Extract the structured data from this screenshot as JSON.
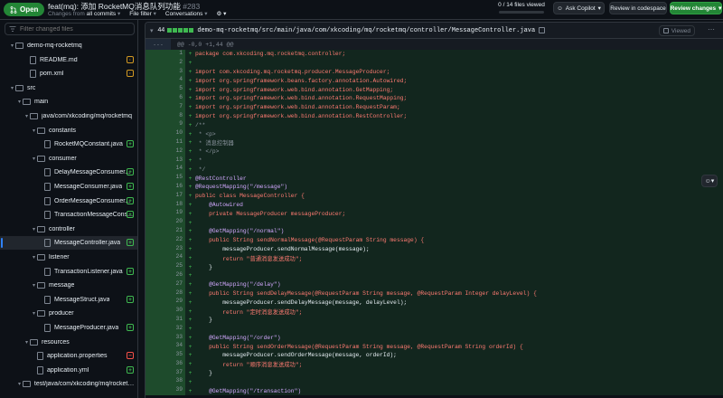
{
  "header": {
    "status_label": "Open",
    "pr_title": "feat(mq): 添加 RocketMQ消息队列功能",
    "pr_number": "#283",
    "changes_from_prefix": "Changes from",
    "changes_from_value": "all commits",
    "file_filter_label": "File filter",
    "conversations_label": "Conversations",
    "files_viewed": "0 / 14 files viewed",
    "ask_copilot_label": "Ask Copilot",
    "review_codespace_label": "Review in codespace",
    "review_changes_label": "Review changes"
  },
  "sidebar": {
    "filter_placeholder": "Filter changed files",
    "items": [
      {
        "label": "demo-mq-rocketmq",
        "type": "folder",
        "status": ""
      },
      {
        "label": "README.md",
        "type": "file",
        "status": "modified"
      },
      {
        "label": "pom.xml",
        "type": "file",
        "status": "modified"
      },
      {
        "label": "src",
        "type": "folder",
        "status": ""
      },
      {
        "label": "main",
        "type": "folder",
        "status": ""
      },
      {
        "label": "java/com/xkcoding/mq/rocketmq",
        "type": "folder",
        "status": ""
      },
      {
        "label": "constants",
        "type": "folder",
        "status": ""
      },
      {
        "label": "RocketMQConstant.java",
        "type": "file",
        "status": "added"
      },
      {
        "label": "consumer",
        "type": "folder",
        "status": ""
      },
      {
        "label": "DelayMessageConsumer...",
        "type": "file",
        "status": "added"
      },
      {
        "label": "MessageConsumer.java",
        "type": "file",
        "status": "added"
      },
      {
        "label": "OrderMessageConsumer...",
        "type": "file",
        "status": "added"
      },
      {
        "label": "TransactionMessageCons...",
        "type": "file",
        "status": "added"
      },
      {
        "label": "controller",
        "type": "folder",
        "status": ""
      },
      {
        "label": "MessageController.java",
        "type": "file",
        "status": "added"
      },
      {
        "label": "listener",
        "type": "folder",
        "status": ""
      },
      {
        "label": "TransactionListener.java",
        "type": "file",
        "status": "added"
      },
      {
        "label": "message",
        "type": "folder",
        "status": ""
      },
      {
        "label": "MessageStruct.java",
        "type": "file",
        "status": "added"
      },
      {
        "label": "producer",
        "type": "folder",
        "status": ""
      },
      {
        "label": "MessageProducer.java",
        "type": "file",
        "status": "added"
      },
      {
        "label": "resources",
        "type": "folder",
        "status": ""
      },
      {
        "label": "application.properties",
        "type": "file",
        "status": "deleted"
      },
      {
        "label": "application.yml",
        "type": "file",
        "status": "added"
      },
      {
        "label": "test/java/com/xkcoding/mq/rocketm...",
        "type": "folder",
        "status": ""
      }
    ]
  },
  "diff": {
    "added_count": "44",
    "file_path": "demo-mq-rocketmq/src/main/java/com/xkcoding/mq/rocketmq/controller/MessageController.java",
    "viewed_label": "Viewed",
    "hunk_expand": "...",
    "hunk_header": "@@ -0,0 +1,44 @@",
    "lines": [
      "package com.xkcoding.mq.rocketmq.controller;",
      "",
      "import com.xkcoding.mq.rocketmq.producer.MessageProducer;",
      "import org.springframework.beans.factory.annotation.Autowired;",
      "import org.springframework.web.bind.annotation.GetMapping;",
      "import org.springframework.web.bind.annotation.RequestMapping;",
      "import org.springframework.web.bind.annotation.RequestParam;",
      "import org.springframework.web.bind.annotation.RestController;",
      "/**",
      " * <p>",
      " * 消息控制器",
      " * </p>",
      " *",
      " */",
      "@RestController",
      "@RequestMapping(\"/message\")",
      "public class MessageController {",
      "    @Autowired",
      "    private MessageProducer messageProducer;",
      "",
      "    @GetMapping(\"/normal\")",
      "    public String sendNormalMessage(@RequestParam String message) {",
      "        messageProducer.sendNormalMessage(message);",
      "        return \"普通消息发送成功\";",
      "    }",
      "",
      "    @GetMapping(\"/delay\")",
      "    public String sendDelayMessage(@RequestParam String message, @RequestParam Integer delayLevel) {",
      "        messageProducer.sendDelayMessage(message, delayLevel);",
      "        return \"定时消息发送成功\";",
      "    }",
      "",
      "    @GetMapping(\"/order\")",
      "    public String sendOrderMessage(@RequestParam String message, @RequestParam String orderId) {",
      "        messageProducer.sendOrderMessage(message, orderId);",
      "        return \"顺序消息发送成功\";",
      "    }",
      "",
      "    @GetMapping(\"/transaction\")"
    ]
  }
}
